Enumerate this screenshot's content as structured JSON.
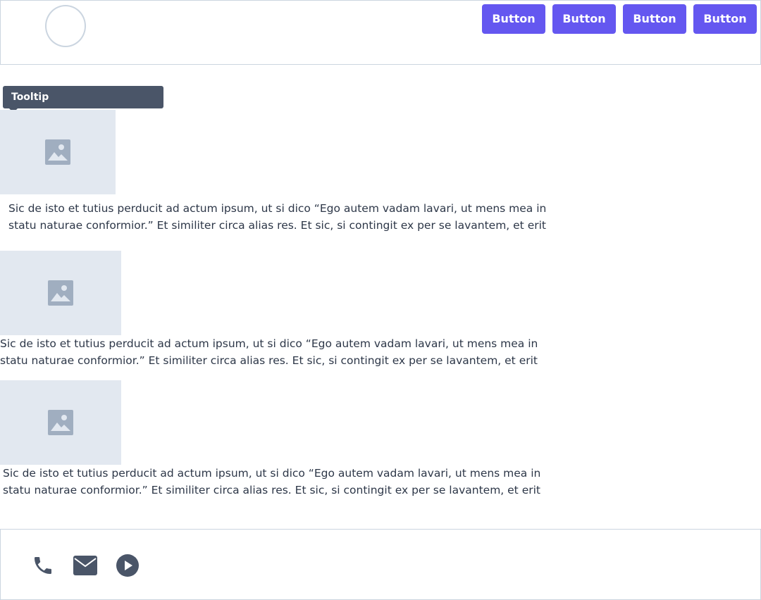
{
  "header": {
    "avatar_icon": "avatar-circle",
    "buttons": [
      {
        "label": "Button"
      },
      {
        "label": "Button"
      },
      {
        "label": "Button"
      },
      {
        "label": "Button"
      }
    ],
    "button_color": "#6457f0"
  },
  "tooltip": {
    "text": "Tooltip",
    "color": "#4a5568"
  },
  "content": {
    "items": [
      {
        "image_icon": "image-icon",
        "text": "Sic de isto et tutius perducit ad actum ipsum, ut si dico “Ego autem vadam lavari, ut mens mea in\nstatu naturae conformior.” Et similiter circa alias res. Et sic, si contingit ex per se lavantem, et erit"
      },
      {
        "image_icon": "image-icon",
        "text": "Sic de isto et tutius perducit ad actum ipsum, ut si dico “Ego autem vadam lavari, ut mens mea in\nstatu naturae conformior.” Et similiter circa alias res. Et sic, si contingit ex per se lavantem, et erit"
      },
      {
        "image_icon": "image-icon",
        "text": "Sic de isto et tutius perducit ad actum ipsum, ut si dico “Ego autem vadam lavari, ut mens mea in\nstatu naturae conformior.” Et similiter circa alias res. Et sic, si contingit ex per se lavantem, et erit"
      }
    ],
    "placeholder_color": "#e2e8f0"
  },
  "footer": {
    "icons": [
      "phone-icon",
      "mail-icon",
      "play-icon"
    ],
    "icon_color": "#4a5568"
  }
}
